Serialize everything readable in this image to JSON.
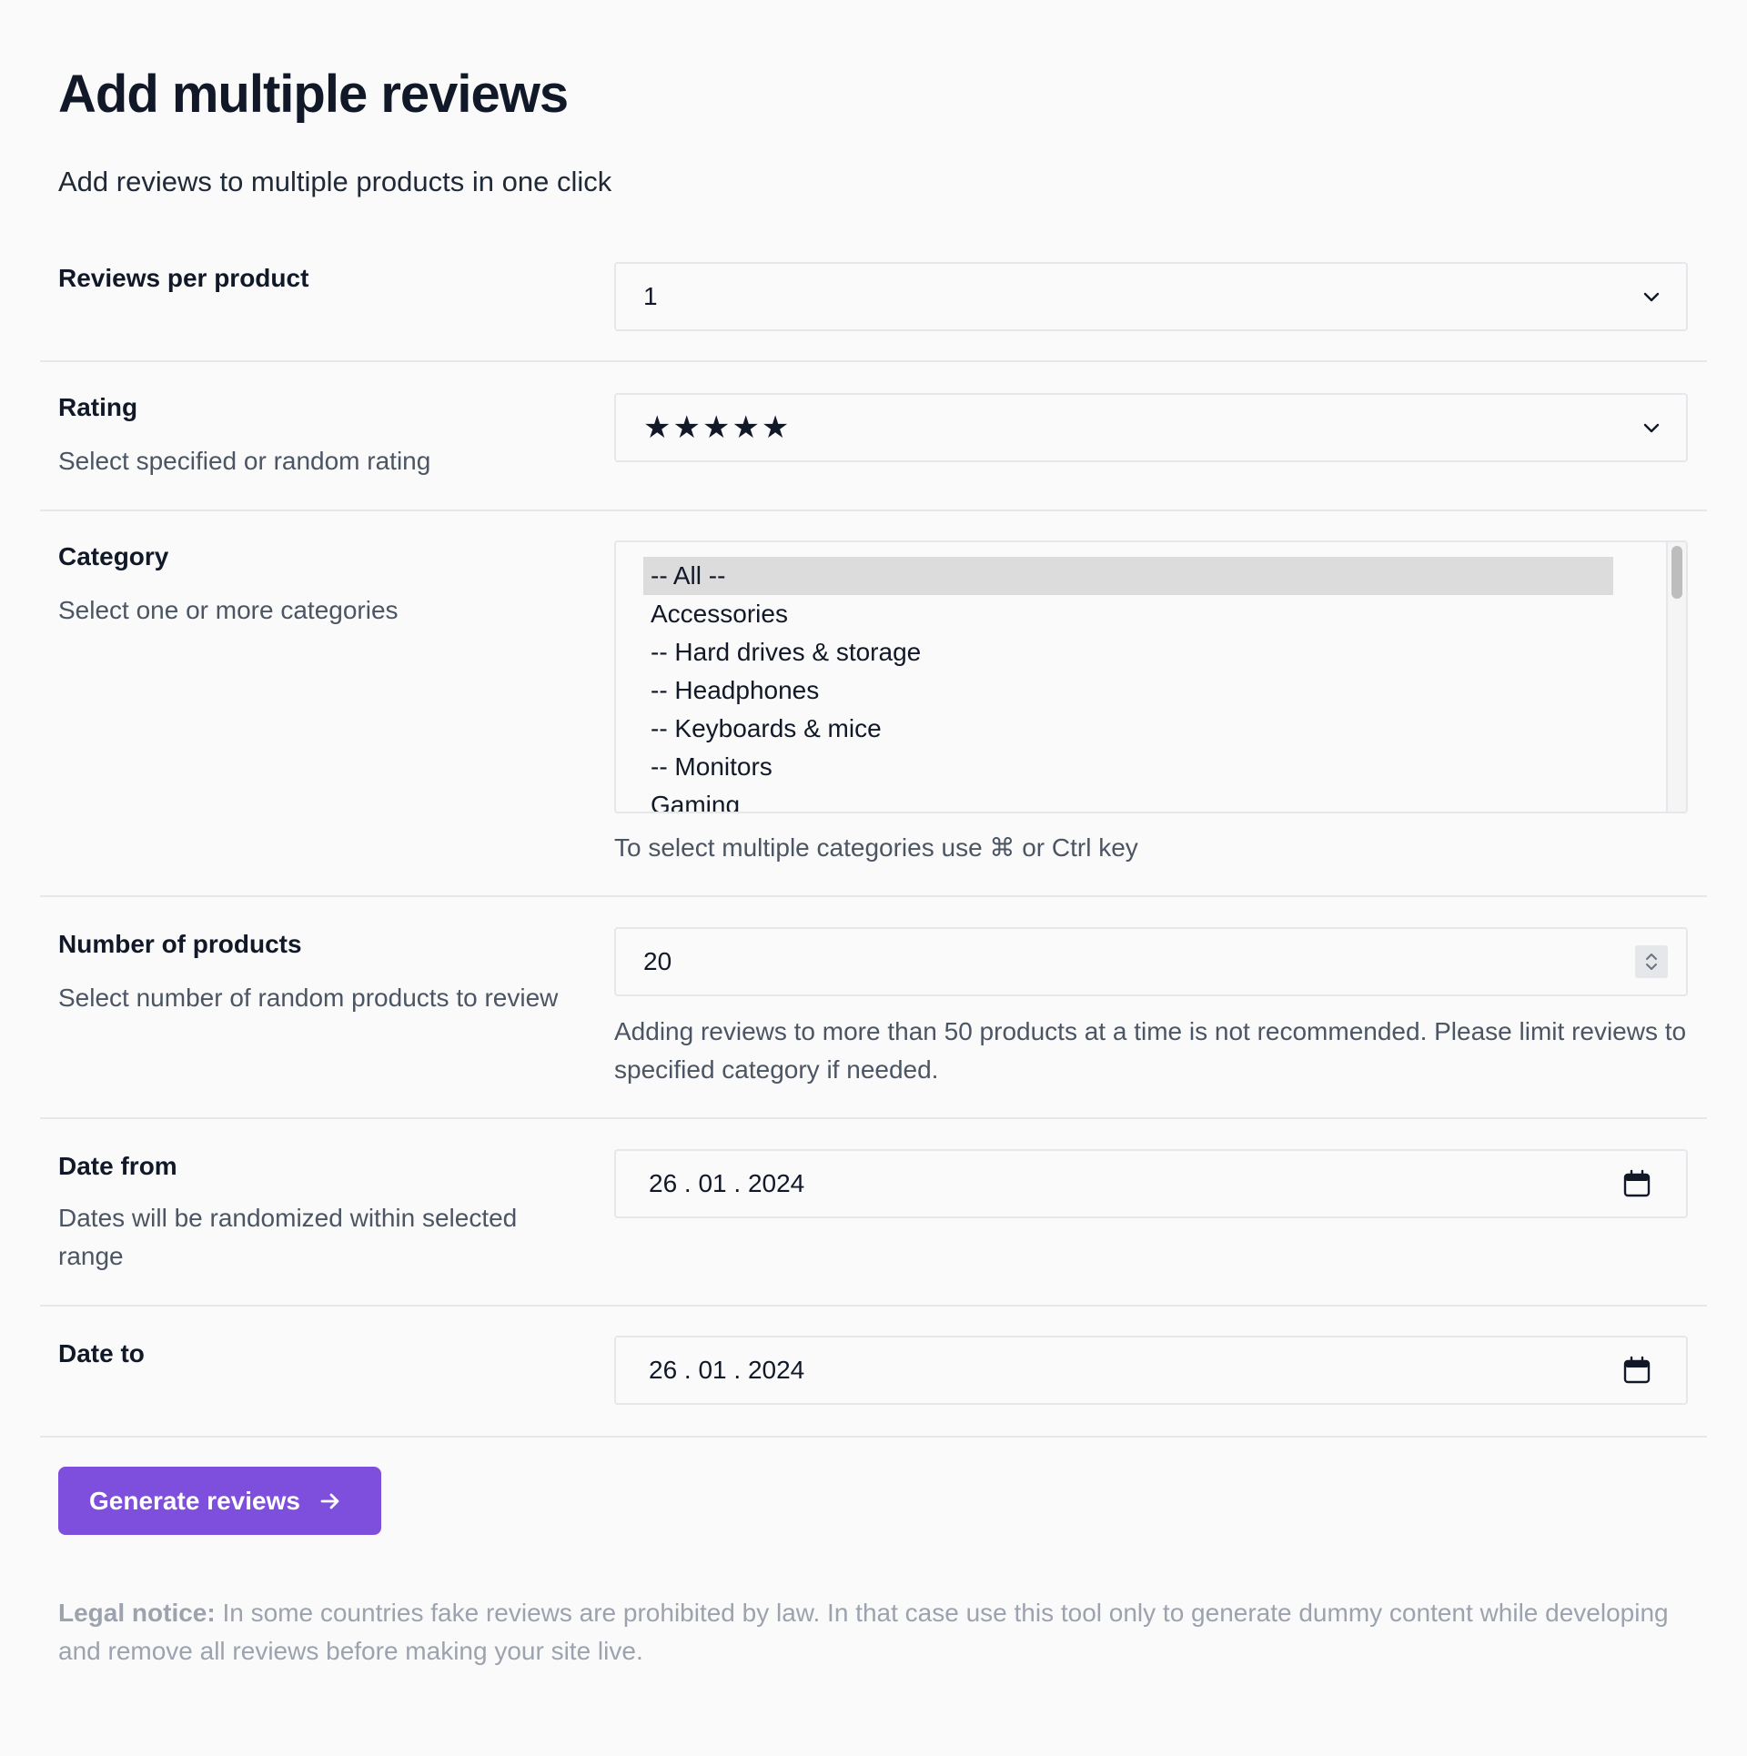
{
  "page": {
    "title": "Add multiple reviews",
    "subtitle": "Add reviews to multiple products in one click"
  },
  "reviews_per_product": {
    "label": "Reviews per product",
    "value": "1"
  },
  "rating": {
    "label": "Rating",
    "description": "Select specified or random rating",
    "value": "★★★★★"
  },
  "category": {
    "label": "Category",
    "description": "Select one or more categories",
    "options": [
      "-- All --",
      "Accessories",
      "-- Hard drives & storage",
      "-- Headphones",
      "-- Keyboards & mice",
      "-- Monitors",
      "Gaming"
    ],
    "selected": "-- All --",
    "hint": "To select multiple categories use ⌘ or Ctrl key"
  },
  "number_of_products": {
    "label": "Number of products",
    "description": "Select number of random products to review",
    "value": "20",
    "hint": "Adding reviews to more than 50 products at a time is not recommended. Please limit reviews to specified category if needed."
  },
  "date_from": {
    "label": "Date from",
    "description": "Dates will be randomized within selected range",
    "value": "26 . 01 . 2024"
  },
  "date_to": {
    "label": "Date to",
    "value": "26 . 01 . 2024"
  },
  "actions": {
    "generate_label": "Generate reviews"
  },
  "legal": {
    "heading": "Legal notice:",
    "text": "In some countries fake reviews are prohibited by law. In that case use this tool only to generate dummy content while developing and remove all reviews before making your site live."
  },
  "colors": {
    "accent": "#7e4fdc",
    "text": "#111827",
    "muted": "#4b5563",
    "border": "#e5e7eb",
    "background": "#fafafa"
  }
}
